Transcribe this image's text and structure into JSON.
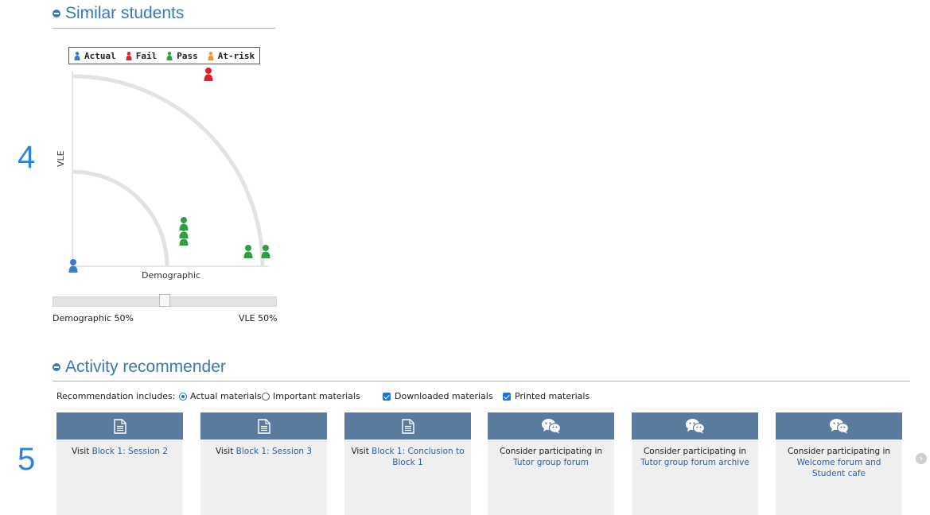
{
  "markers": {
    "section4": "4",
    "section5": "5"
  },
  "similar": {
    "heading": "Similar students",
    "legend": [
      {
        "label": "Actual",
        "color": "#3b7dc4"
      },
      {
        "label": "Fail",
        "color": "#e01f26"
      },
      {
        "label": "Pass",
        "color": "#2e9e3e"
      },
      {
        "label": "At-risk",
        "color": "#f0962a"
      }
    ],
    "y_label": "VLE",
    "x_label": "Demographic",
    "slider": {
      "left_label": "Demographic 50%",
      "right_label": "VLE 50%",
      "value": 0.5
    }
  },
  "recommender": {
    "heading": "Activity recommender",
    "includes_label": "Recommendation includes:",
    "radio": [
      {
        "label": "Actual materials",
        "checked": true
      },
      {
        "label": "Important materials",
        "checked": false
      }
    ],
    "checks": [
      {
        "label": "Downloaded materials",
        "checked": true
      },
      {
        "label": "Printed materials",
        "checked": true
      }
    ],
    "cards": [
      {
        "icon": "document-icon",
        "prefix": "Visit ",
        "link": "Block 1: Session 2"
      },
      {
        "icon": "document-icon",
        "prefix": "Visit ",
        "link": "Block 1: Session 3"
      },
      {
        "icon": "document-icon",
        "prefix": "Visit ",
        "link": "Block 1: Conclusion to Block 1"
      },
      {
        "icon": "chat-icon",
        "prefix": "Consider participating in ",
        "link": "Tutor group forum"
      },
      {
        "icon": "chat-icon",
        "prefix": "Consider participating in ",
        "link": "Tutor group forum archive"
      },
      {
        "icon": "chat-icon",
        "prefix": "Consider participating in ",
        "link": "Welcome forum and Student cafe"
      }
    ]
  }
}
